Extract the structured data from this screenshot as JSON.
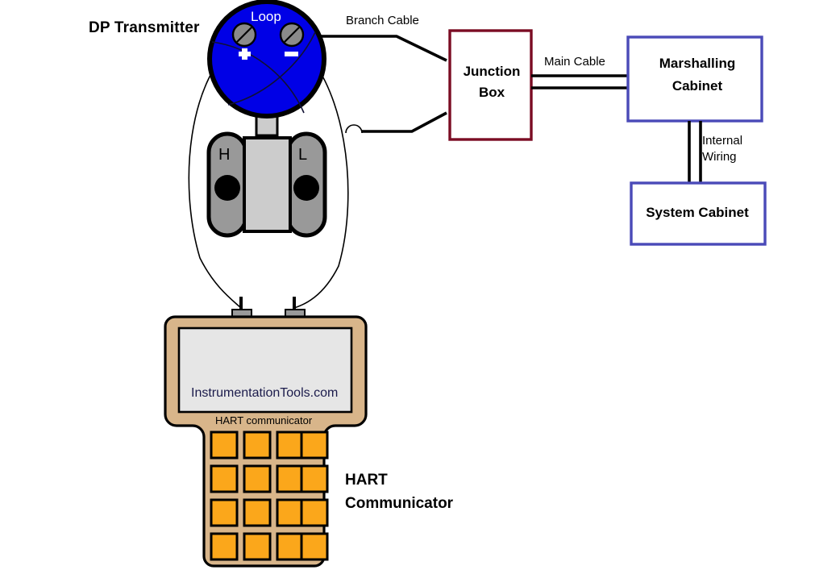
{
  "diagram": {
    "title": "HART Communicator connection to DP Transmitter loop",
    "background": "#ffffff"
  },
  "labels": {
    "dp_transmitter": "DP Transmitter",
    "loop": "Loop",
    "branch_cable": "Branch Cable",
    "main_cable": "Main Cable",
    "internal_wiring_line1": "Internal",
    "internal_wiring_line2": "Wiring",
    "junction_box_line1": "Junction",
    "junction_box_line2": "Box",
    "marshalling_cabinet_line1": "Marshalling",
    "marshalling_cabinet_line2": "Cabinet",
    "system_cabinet": "System Cabinet",
    "port_high": "H",
    "port_low": "L",
    "watermark": "InstrumentationTools.com",
    "hart_communicator_small": "HART communicator",
    "hart_communicator_line1": "HART",
    "hart_communicator_line2": "Communicator",
    "terminal_plus": "+",
    "terminal_minus": "−"
  },
  "colors": {
    "transmitter_body": "#0000e6",
    "transmitter_outline": "#000000",
    "terminal_screw": "#8a8a8a",
    "flange_gray": "#999999",
    "neck_gray": "#cccccc",
    "junction_box_border": "#7b0c23",
    "cabinet_border": "#4a4ab8",
    "communicator_case": "#d8b58a",
    "communicator_screen": "#e6e6e6",
    "key_orange": "#fba71b",
    "cable_black": "#000000",
    "watermark_text": "#1b1b4b"
  },
  "components": {
    "dp_transmitter": {
      "type": "circle-head-transmitter",
      "terminals": [
        "+",
        "-"
      ],
      "ports": [
        "H",
        "L"
      ]
    },
    "junction_box": {
      "type": "box",
      "border_color": "#7b0c23"
    },
    "marshalling_cabinet": {
      "type": "box",
      "border_color": "#4a4ab8"
    },
    "system_cabinet": {
      "type": "box",
      "border_color": "#4a4ab8"
    },
    "hart_communicator": {
      "type": "handheld",
      "keypad_rows": 4,
      "keypad_cols": 4,
      "key_count": 16,
      "probe_count": 2
    }
  },
  "connections": [
    {
      "name": "branch-cable-upper",
      "from": "dp-transmitter-plus-terminal",
      "to": "junction-box-left-upper",
      "label": "Branch Cable"
    },
    {
      "name": "branch-cable-lower",
      "from": "dp-transmitter-loop",
      "to": "junction-box-left-lower",
      "label": ""
    },
    {
      "name": "main-cable",
      "from": "junction-box-right",
      "to": "marshalling-cabinet-left",
      "label": "Main Cable",
      "conductors": 2
    },
    {
      "name": "internal-wiring",
      "from": "marshalling-cabinet-bottom",
      "to": "system-cabinet-top",
      "label": "Internal Wiring",
      "conductors": 2
    },
    {
      "name": "test-lead-plus",
      "from": "dp-transmitter-plus-terminal",
      "to": "hart-communicator-probe-left",
      "label": ""
    },
    {
      "name": "test-lead-minus",
      "from": "dp-transmitter-minus-terminal",
      "to": "hart-communicator-probe-right",
      "label": ""
    }
  ]
}
